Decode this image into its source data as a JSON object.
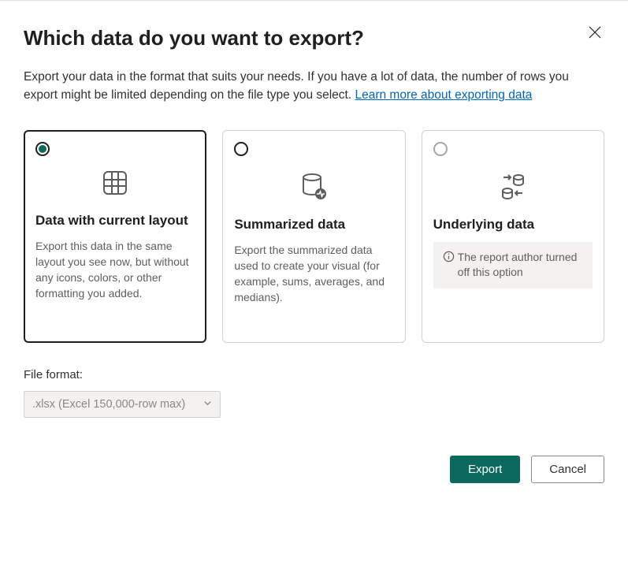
{
  "dialog": {
    "title": "Which data do you want to export?",
    "subtitle_pre": "Export your data in the format that suits your needs. If you have a lot of data, the number of rows you export might be limited depending on the file type you select.  ",
    "learn_more": "Learn more about exporting data"
  },
  "options": [
    {
      "title": "Data with current layout",
      "desc": "Export this data in the same layout you see now, but without any icons, colors, or other formatting you added.",
      "selected": true,
      "disabled": false
    },
    {
      "title": "Summarized data",
      "desc": "Export the summarized data used to create your visual (for example, sums, averages, and medians).",
      "selected": false,
      "disabled": false
    },
    {
      "title": "Underlying data",
      "disabled_msg": "The report author turned off this option",
      "selected": false,
      "disabled": true
    }
  ],
  "file_format": {
    "label": "File format:",
    "value": ".xlsx (Excel 150,000-row max)"
  },
  "buttons": {
    "export": "Export",
    "cancel": "Cancel"
  }
}
